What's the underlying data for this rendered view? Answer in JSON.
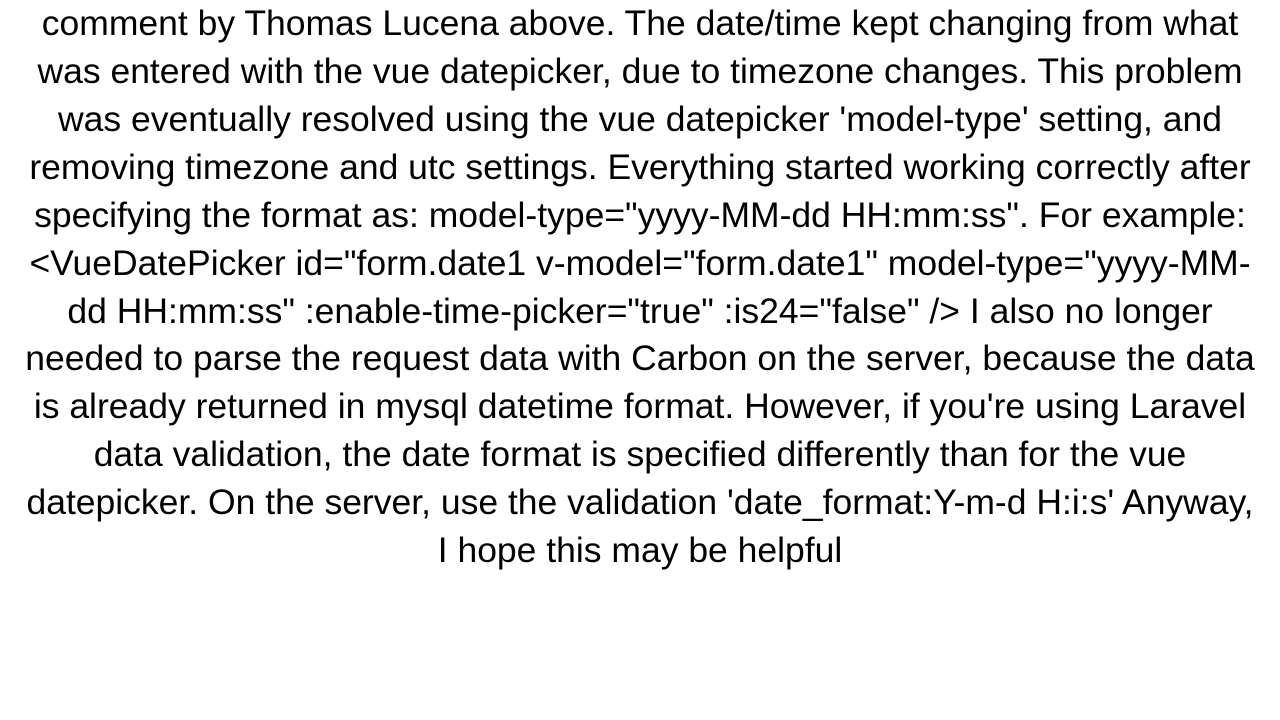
{
  "comment": {
    "body": "comment by Thomas Lucena above.  The date/time kept changing from what was entered with the vue datepicker, due to timezone changes. This problem was eventually resolved using the vue datepicker 'model-type' setting, and removing timezone and utc settings.  Everything started working correctly after specifying the format as: model-type=\"yyyy-MM-dd HH:mm:ss\".  For example: <VueDatePicker id=\"form.date1 v-model=\"form.date1\" model-type=\"yyyy-MM-dd HH:mm:ss\" :enable-time-picker=\"true\" :is24=\"false\" />  I also no longer needed to parse the request data with Carbon on the server, because the data is already returned in mysql datetime format. However, if you're using Laravel data validation, the date format is specified differently than for the vue datepicker.  On the server, use the validation 'date_format:Y-m-d H:i:s' Anyway, I hope this may be helpful"
  }
}
